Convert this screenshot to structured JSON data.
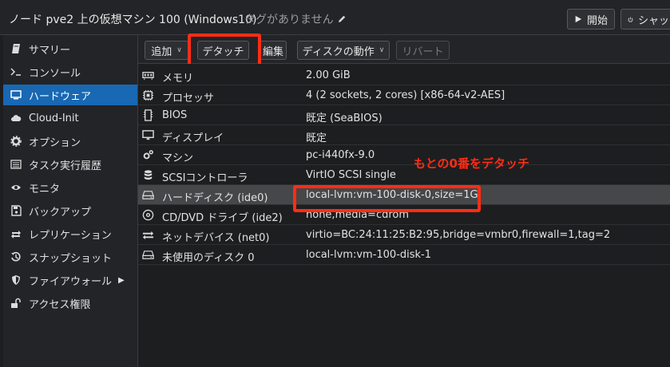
{
  "window": {
    "title": "ノード pve2 上の仮想マシン 100 (Windows10)",
    "tags_text": "タグがありません",
    "start_label": "開始",
    "shutdown_label": "シャッ"
  },
  "sidebar": {
    "items": [
      {
        "label": "サマリー",
        "icon": "notebook-icon"
      },
      {
        "label": "コンソール",
        "icon": "terminal-icon"
      },
      {
        "label": "ハードウェア",
        "icon": "monitor-icon",
        "active": true
      },
      {
        "label": "Cloud-Init",
        "icon": "cloud-icon"
      },
      {
        "label": "オプション",
        "icon": "gear-icon"
      },
      {
        "label": "タスク実行履歴",
        "icon": "list-icon"
      },
      {
        "label": "モニタ",
        "icon": "eye-icon"
      },
      {
        "label": "バックアップ",
        "icon": "floppy-icon"
      },
      {
        "label": "レプリケーション",
        "icon": "sync-icon"
      },
      {
        "label": "スナップショット",
        "icon": "history-icon"
      },
      {
        "label": "ファイアウォール",
        "icon": "shield-icon",
        "has_submenu": true
      },
      {
        "label": "アクセス権限",
        "icon": "unlock-icon"
      }
    ]
  },
  "toolbar": {
    "add_label": "追加",
    "detach_label": "デタッチ",
    "edit_label": "編集",
    "disk_action_label": "ディスクの動作",
    "revert_label": "リバート"
  },
  "hardware": [
    {
      "key": "メモリ",
      "value": "2.00 GiB",
      "icon": "memory-icon"
    },
    {
      "key": "プロセッサ",
      "value": "4 (2 sockets, 2 cores) [x86-64-v2-AES]",
      "icon": "cpu-icon"
    },
    {
      "key": "BIOS",
      "value": "既定 (SeaBIOS)",
      "icon": "microchip-icon"
    },
    {
      "key": "ディスプレイ",
      "value": "既定",
      "icon": "desktop-icon"
    },
    {
      "key": "マシン",
      "value": "pc-i440fx-9.0",
      "icon": "cogs-icon"
    },
    {
      "key": "SCSIコントローラ",
      "value": "VirtIO SCSI single",
      "icon": "database-icon"
    },
    {
      "key": "ハードディスク (ide0)",
      "value": "local-lvm:vm-100-disk-0,size=1G",
      "icon": "hdd-icon",
      "selected": true
    },
    {
      "key": "CD/DVD ドライブ (ide2)",
      "value": "none,media=cdrom",
      "icon": "cdrom-icon"
    },
    {
      "key": "ネットデバイス (net0)",
      "value": "virtio=BC:24:11:25:B2:95,bridge=vmbr0,firewall=1,tag=2",
      "icon": "exchange-icon"
    },
    {
      "key": "未使用のディスク 0",
      "value": "local-lvm:vm-100-disk-1",
      "icon": "hdd-icon"
    }
  ],
  "annotation": {
    "text": "もとの0番をデタッチ",
    "color": "#ff2d14"
  },
  "colors": {
    "accent": "#1968b3",
    "highlight": "#ff2d14"
  }
}
